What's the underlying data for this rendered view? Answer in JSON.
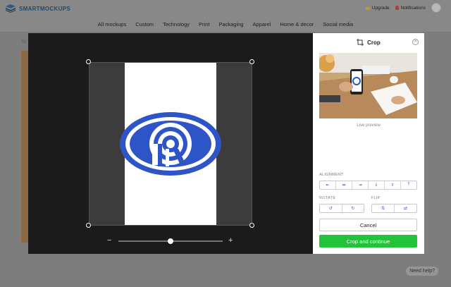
{
  "app": {
    "brand": "SMARTMOCKUPS",
    "upgrade_label": "Upgrade",
    "notifications_label": "Notifications"
  },
  "nav": {
    "items": [
      "All mockups",
      "Custom",
      "Technology",
      "Print",
      "Packaging",
      "Apparel",
      "Home & decor",
      "Social media"
    ]
  },
  "background": {
    "crumb": "Sc",
    "help_label": "Need help?"
  },
  "panel": {
    "title": "Crop",
    "preview_label": "Live preview",
    "alignment_label": "ALIGNMENT",
    "rotate_label": "ROTATE",
    "flip_label": "FLIP",
    "cancel_label": "Cancel",
    "continue_label": "Crop and continue"
  },
  "editor": {
    "zoom_level": 0.5
  },
  "colors": {
    "accent_green": "#22c338",
    "logo_blue": "#2e55c7",
    "icon_blue": "#2b58c4",
    "modal_dark": "#1b1b1b"
  }
}
